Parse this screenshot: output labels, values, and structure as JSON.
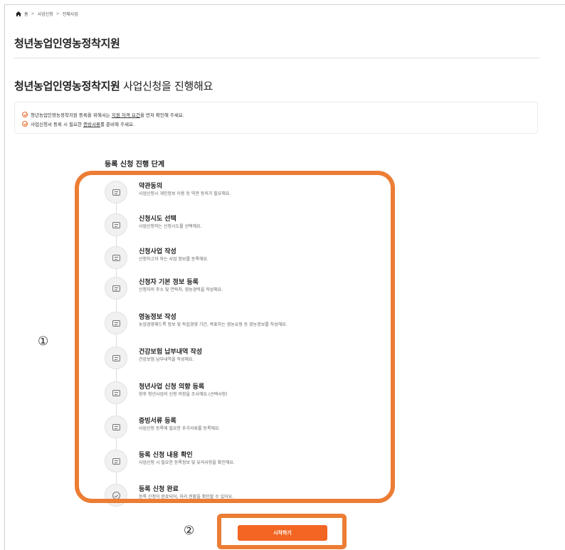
{
  "breadcrumb": {
    "icon": "home-icon",
    "items": [
      "홈",
      "사업신청",
      "전체사업"
    ]
  },
  "page_title": "청년농업인영농정착지원",
  "section_heading": {
    "bold": "청년농업인영농정착지원",
    "rest": " 사업신청을 진행해요"
  },
  "notices": [
    {
      "icon": "check-circle-icon",
      "before": "청년농업인영농정착지원 등록을 위해서는 ",
      "link": "지원 자격 요건",
      "after": "을 먼저 확인해 주세요."
    },
    {
      "icon": "check-circle-icon",
      "before": "사업신청서 등록 시 필요한 ",
      "link": "증빙서류",
      "after": "를 준비해 주세요."
    }
  ],
  "steps_heading": "등록 신청 진행 단계",
  "steps": [
    {
      "icon": "agreement-icon",
      "title": "약관동의",
      "desc": "사업신청시 개인정보 이용 등 약관 동의가 필요해요."
    },
    {
      "icon": "form-icon",
      "title": "신청시도 선택",
      "desc": "사업신청하는 신청시도를 선택해요."
    },
    {
      "icon": "form-icon",
      "title": "신청사업 작성",
      "desc": "신청하고자 하는 사업 정보를 등록해요."
    },
    {
      "icon": "form-icon",
      "title": "신청자 기본 정보 등록",
      "desc": "신청자의 주소 및 연락처, 영농경력을 작성해요."
    },
    {
      "icon": "form-icon",
      "title": "영농정보 작성",
      "desc": "농업경영체드록 정보 및 독립경영 기간, 목표하는 영농유형 등 영농정보를 작성해요."
    },
    {
      "icon": "form-icon",
      "title": "건강보험 납부내역 작성",
      "desc": "건강보험 납부내역을 작성해요."
    },
    {
      "icon": "form-icon",
      "title": "청년사업 신청 의향 등록",
      "desc": "향후 청년사업의 신청 의향을 조사해요.(선택사항)"
    },
    {
      "icon": "edit-icon",
      "title": "증빙서류 등록",
      "desc": "사업신청 등록에 필요한 추가서류를 등록해요."
    },
    {
      "icon": "clipboard-check-icon",
      "title": "등록 신청 내용 확인",
      "desc": "사업신청 시 필요한 등록정보 및 유의사항을 확인해요."
    },
    {
      "icon": "check-circle-icon",
      "title": "등록 신청 완료",
      "desc": "등록 신청이 완료되어, 처리 현황을 확인할 수 있어요."
    }
  ],
  "annotations": {
    "one": "①",
    "two": "②"
  },
  "start_button": "시작하기",
  "colors": {
    "accent": "#f26522",
    "highlight_frame": "#ec7d34"
  }
}
